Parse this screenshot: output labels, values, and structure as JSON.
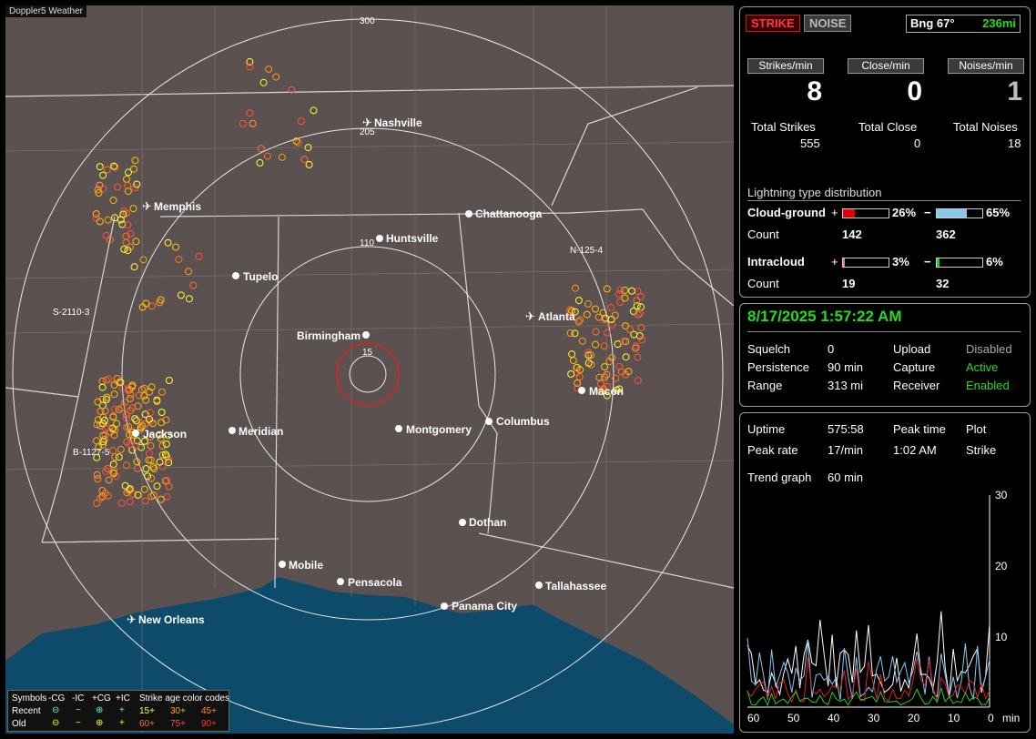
{
  "app_title": "Doppler5 Weather",
  "buttons": {
    "strike": "STRIKE",
    "noise": "NOISE"
  },
  "bearing": {
    "label": "Bng 67°",
    "distance": "236mi"
  },
  "rates": {
    "strikes_label": "Strikes/min",
    "strikes_value": "8",
    "close_label": "Close/min",
    "close_value": "0",
    "noises_label": "Noises/min",
    "noises_value": "1"
  },
  "totals": {
    "strikes_label": "Total Strikes",
    "strikes_value": "555",
    "close_label": "Total Close",
    "close_value": "0",
    "noises_label": "Total Noises",
    "noises_value": "18"
  },
  "distribution": {
    "title": "Lightning type distribution",
    "cg_label": "Cloud-ground",
    "cg_plus_pct": "26%",
    "cg_plus_fraction": 0.26,
    "cg_minus_pct": "65%",
    "cg_minus_fraction": 0.65,
    "count_label": "Count",
    "cg_plus_count": "142",
    "cg_minus_count": "362",
    "ic_label": "Intracloud",
    "ic_plus_pct": "3%",
    "ic_plus_fraction": 0.03,
    "ic_minus_pct": "6%",
    "ic_minus_fraction": 0.06,
    "ic_plus_count": "19",
    "ic_minus_count": "32",
    "plus_sign": "+",
    "minus_sign": "−"
  },
  "status": {
    "datetime": "8/17/2025 1:57:22 AM",
    "squelch_label": "Squelch",
    "squelch_value": "0",
    "persistence_label": "Persistence",
    "persistence_value": "90 min",
    "range_label": "Range",
    "range_value": "313 mi",
    "upload_label": "Upload",
    "upload_value": "Disabled",
    "capture_label": "Capture",
    "capture_value": "Active",
    "receiver_label": "Receiver",
    "receiver_value": "Enabled"
  },
  "stats": {
    "uptime_label": "Uptime",
    "uptime_value": "575:58",
    "peaktime_label": "Peak time",
    "peaktime_value": "1:02 AM",
    "plot_label": "Plot",
    "plot_value": "Strike",
    "peakrate_label": "Peak rate",
    "peakrate_value": "17/min",
    "trend_label": "Trend graph",
    "trend_value": "60 min"
  },
  "trend_axis": {
    "y_ticks": [
      "30",
      "20",
      "10"
    ],
    "x_ticks": [
      "60",
      "50",
      "40",
      "30",
      "20",
      "10",
      "0"
    ],
    "x_unit": "min"
  },
  "map": {
    "range_rings": [
      "300",
      "205",
      "110",
      "15"
    ],
    "cities": [
      "Nashville",
      "Memphis",
      "Chattanooga",
      "Huntsville",
      "Tupelo",
      "Atlanta",
      "Birmingham",
      "Macon",
      "Jackson",
      "Meridian",
      "Montgomery",
      "Columbus",
      "Dothan",
      "Mobile",
      "Pensacola",
      "Tallahassee",
      "Panama City",
      "New Orleans"
    ],
    "storm_labels": [
      "N-125-4",
      "S-2110-3",
      "B-1127-5"
    ]
  },
  "legend": {
    "symbols_label": "Symbols",
    "neg_cg": "-CG",
    "neg_ic": "-IC",
    "pos_cg": "+CG",
    "pos_ic": "+IC",
    "age_label": "Strike age color codes",
    "recent_label": "Recent",
    "old_label": "Old",
    "ages_recent": [
      "15+",
      "30+",
      "45+"
    ],
    "ages_old": [
      "60+",
      "75+",
      "90+"
    ]
  },
  "colors": {
    "accent_green": "#22dd22",
    "strike_red": "#ff3030",
    "ic_blue": "#88c8f0"
  }
}
